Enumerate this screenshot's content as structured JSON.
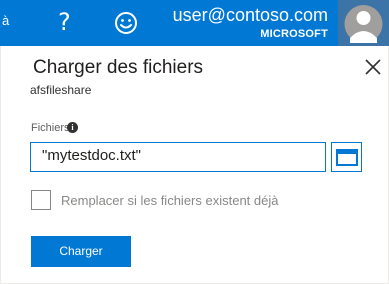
{
  "topbar": {
    "partial_text": "à",
    "help_symbol": "?",
    "user_email": "user@contoso.com",
    "user_org": "MICROSOFT"
  },
  "panel": {
    "title": "Charger des fichiers",
    "subtitle": "afsfileshare",
    "files_label": "Fichiers",
    "info_symbol": "i",
    "file_value": "\"mytestdoc.txt\"",
    "overwrite_label": "Remplacer si les fichiers existent déjà",
    "overwrite_checked": false,
    "upload_label": "Charger"
  },
  "colors": {
    "accent": "#0078d4",
    "text": "#323130",
    "muted": "#8a8886"
  },
  "icons": {
    "help": "help-icon",
    "feedback": "smile-icon",
    "avatar": "avatar",
    "close": "close-icon",
    "info": "info-icon",
    "browse": "folder-icon"
  }
}
